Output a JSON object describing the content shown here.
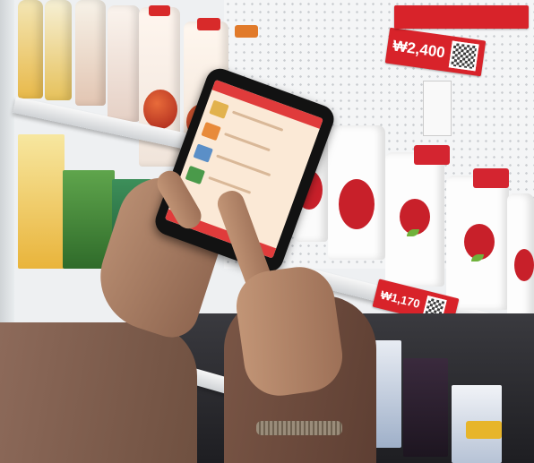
{
  "scene": {
    "description_colors": {
      "price_tag": "#d8232a",
      "milk_label": "#c8202a",
      "app_header": "#e03b3b"
    }
  },
  "price_tags": [
    {
      "text": "₩2,400"
    },
    {
      "text": "₩1,170"
    }
  ]
}
